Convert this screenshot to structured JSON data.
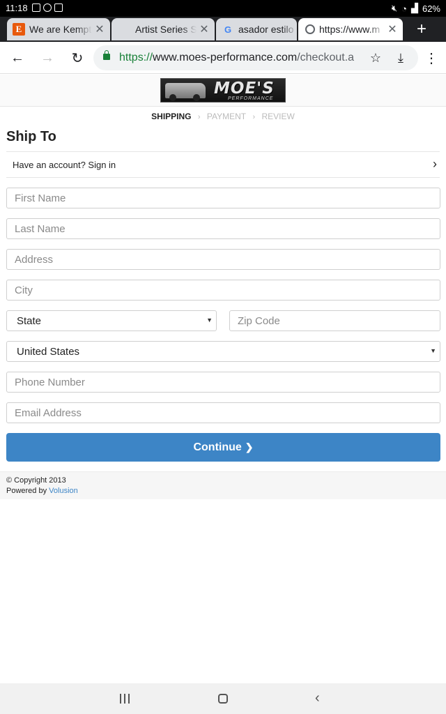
{
  "status_bar": {
    "time": "11:18",
    "battery": "62%",
    "left_icons": [
      "image-icon",
      "notification-icon",
      "calendar-icon"
    ],
    "right_icons": [
      "mute-icon",
      "wifi-icon",
      "signal-icon"
    ]
  },
  "tabs": [
    {
      "title": "We are Kempte",
      "favicon": "E",
      "favicon_color": "#e8590c",
      "active": false
    },
    {
      "title": "Artist Series Sp",
      "favicon": "",
      "active": false
    },
    {
      "title": "asador estilo",
      "favicon": "G",
      "favicon_color": "#4285f4",
      "active": false
    },
    {
      "title": "https://www.m",
      "favicon": "globe",
      "active": true
    }
  ],
  "new_tab_label": "+",
  "toolbar": {
    "url_scheme": "https://",
    "url_host": "www.moes-performance.com",
    "url_path": "/checkout.a"
  },
  "site": {
    "logo_text": "MOE'S",
    "logo_subtext": "PERFORMANCE"
  },
  "checkout_steps": [
    {
      "label": "SHIPPING",
      "active": true
    },
    {
      "label": "PAYMENT",
      "active": false
    },
    {
      "label": "REVIEW",
      "active": false
    }
  ],
  "step_separator": "›",
  "form": {
    "title": "Ship To",
    "signin_prompt": "Have an account? Sign in",
    "first_name_placeholder": "First Name",
    "last_name_placeholder": "Last Name",
    "address_placeholder": "Address",
    "city_placeholder": "City",
    "state_value": "State",
    "zip_placeholder": "Zip Code",
    "country_value": "United States",
    "phone_placeholder": "Phone Number",
    "email_placeholder": "Email Address",
    "continue_label": "Continue"
  },
  "footer": {
    "copyright": "© Copyright 2013",
    "powered_by": "Powered by",
    "powered_link": "Volusion"
  },
  "colors": {
    "accent": "#3d85c6",
    "secure_green": "#188038",
    "tab_strip": "#202124"
  }
}
